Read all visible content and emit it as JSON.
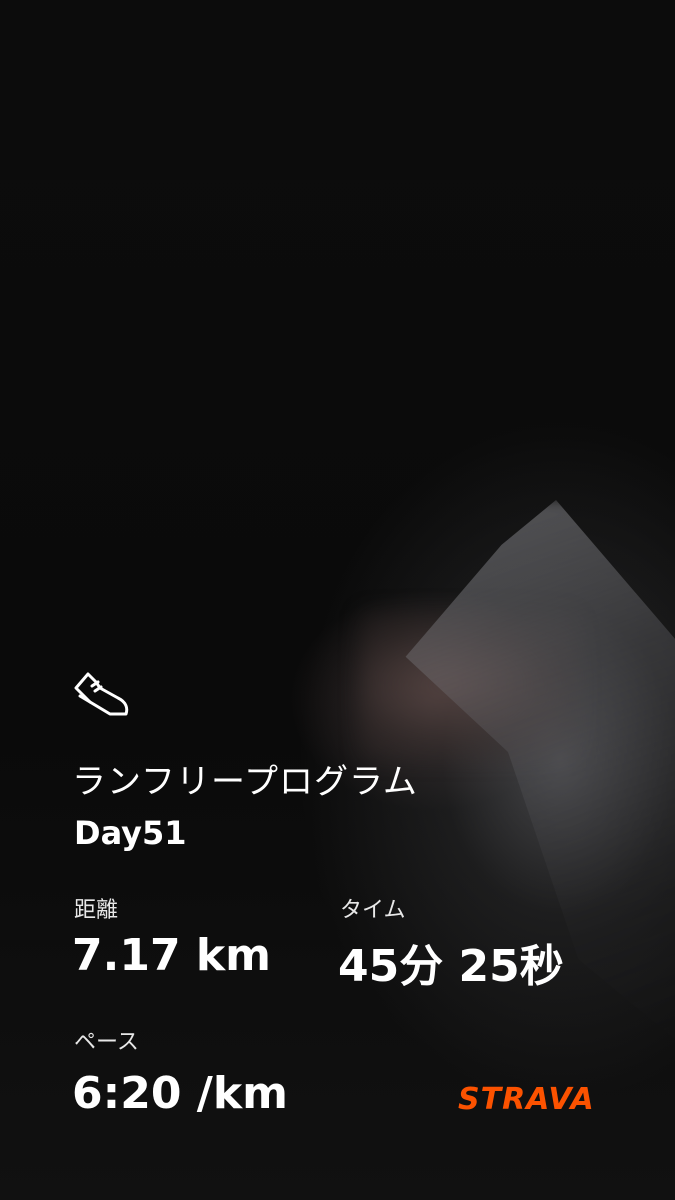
{
  "activity": {
    "icon": "running-shoe-icon",
    "title": "ランフリープログラム",
    "subtitle": "Day51"
  },
  "stats": {
    "distance_label": "距離",
    "distance_value": "7.17 km",
    "time_label": "タイム",
    "time_value": "45分 25秒",
    "pace_label": "ペース",
    "pace_value": "6:20 /km"
  },
  "brand": {
    "name": "STRAVA",
    "color": "#fc5200"
  },
  "colors": {
    "text": "#ffffff",
    "background": "#0b0b0b"
  }
}
